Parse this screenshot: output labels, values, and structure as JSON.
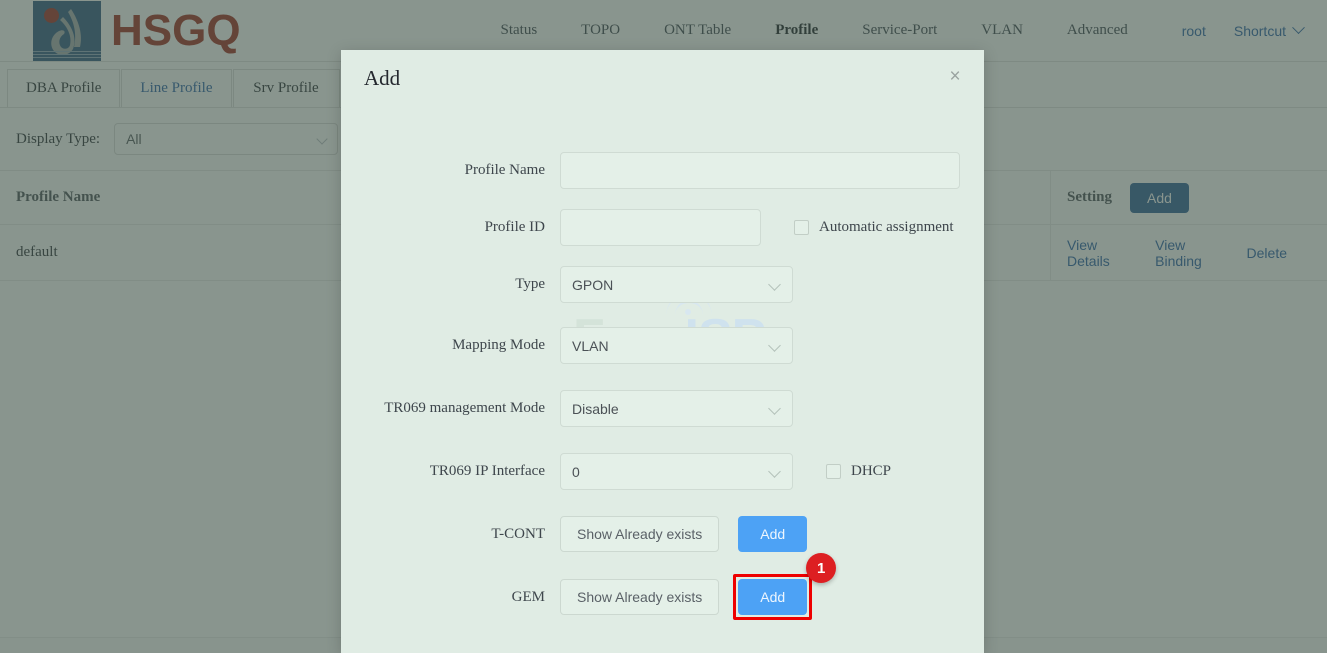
{
  "brand": {
    "name": "HSGQ"
  },
  "nav": {
    "items": [
      {
        "label": "Status",
        "active": false
      },
      {
        "label": "TOPO",
        "active": false
      },
      {
        "label": "ONT Table",
        "active": false
      },
      {
        "label": "Profile",
        "active": true
      },
      {
        "label": "Service-Port",
        "active": false
      },
      {
        "label": "VLAN",
        "active": false
      },
      {
        "label": "Advanced",
        "active": false
      }
    ],
    "user": "root",
    "shortcut": "Shortcut"
  },
  "tabs": [
    {
      "label": "DBA Profile",
      "active": false
    },
    {
      "label": "Line Profile",
      "active": true
    },
    {
      "label": "Srv Profile",
      "active": false
    }
  ],
  "filter": {
    "label": "Display Type:",
    "value": "All"
  },
  "table": {
    "headers": {
      "name": "Profile Name",
      "setting": "Setting"
    },
    "add_label": "Add",
    "rows": [
      {
        "name": "default",
        "actions": [
          "View Details",
          "View Binding",
          "Delete"
        ]
      }
    ]
  },
  "watermark": {
    "part1": "Foro",
    "part2": "ISP"
  },
  "modal": {
    "title": "Add",
    "close_label": "×",
    "fields": {
      "profile_name": {
        "label": "Profile Name",
        "value": "",
        "placeholder": ""
      },
      "profile_id": {
        "label": "Profile ID",
        "value": "",
        "placeholder": ""
      },
      "automatic_assignment": {
        "label": "Automatic assignment",
        "checked": false
      },
      "type": {
        "label": "Type",
        "value": "GPON"
      },
      "mapping_mode": {
        "label": "Mapping Mode",
        "value": "VLAN"
      },
      "tr069_management_mode": {
        "label": "TR069 management Mode",
        "value": "Disable"
      },
      "tr069_ip_interface": {
        "label": "TR069 IP Interface",
        "value": "0"
      },
      "dhcp": {
        "label": "DHCP",
        "checked": false
      },
      "tcont": {
        "label": "T-CONT",
        "show_label": "Show Already exists",
        "add_label": "Add"
      },
      "gem": {
        "label": "GEM",
        "show_label": "Show Already exists",
        "add_label": "Add"
      }
    }
  },
  "annotation": {
    "badge": "1"
  },
  "colors": {
    "brand_red": "#9e2a1f",
    "logo_blue": "#2e5782",
    "link_blue": "#2a63a8",
    "button_blue": "#4da2f5",
    "table_button_blue": "#2a5f96",
    "modal_bg": "#e0ece4",
    "annotation_red": "#ee0000",
    "badge_red": "#dd1f22"
  }
}
